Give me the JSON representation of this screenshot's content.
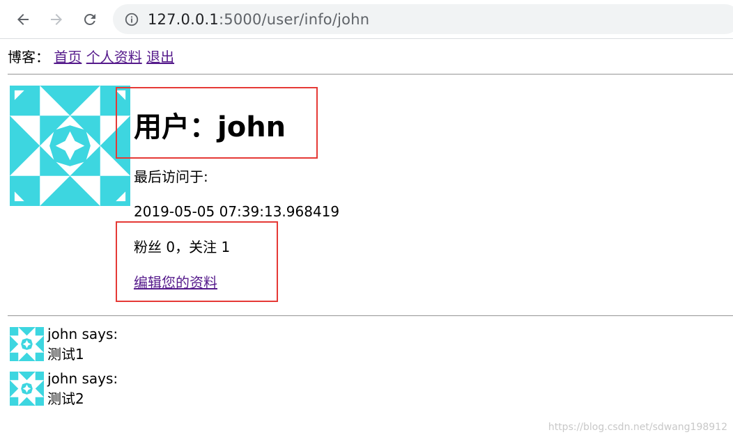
{
  "browser": {
    "url_host": "127.0.0.1",
    "url_path": ":5000/user/info/john",
    "icons": [
      "back-arrow-icon",
      "forward-arrow-icon",
      "reload-icon",
      "info-icon"
    ]
  },
  "nav": {
    "brand": "博客：",
    "links": [
      "首页",
      "个人资料",
      "退出"
    ]
  },
  "profile": {
    "title": "用户：john",
    "last_seen_label": "最后访问于:",
    "last_seen_time": "2019-05-05 07:39:13.968419",
    "follow_stats": "粉丝 0，关注 1",
    "edit_link": "编辑您的资料"
  },
  "posts": [
    {
      "author_line": "john says:",
      "body": "测试1"
    },
    {
      "author_line": "john says:",
      "body": "测试2"
    }
  ],
  "watermark": "https://blog.csdn.net/sdwang198912",
  "colors": {
    "avatar": "#3dd6e0",
    "link": "#551a8b",
    "annotation_box": "#e53935"
  }
}
